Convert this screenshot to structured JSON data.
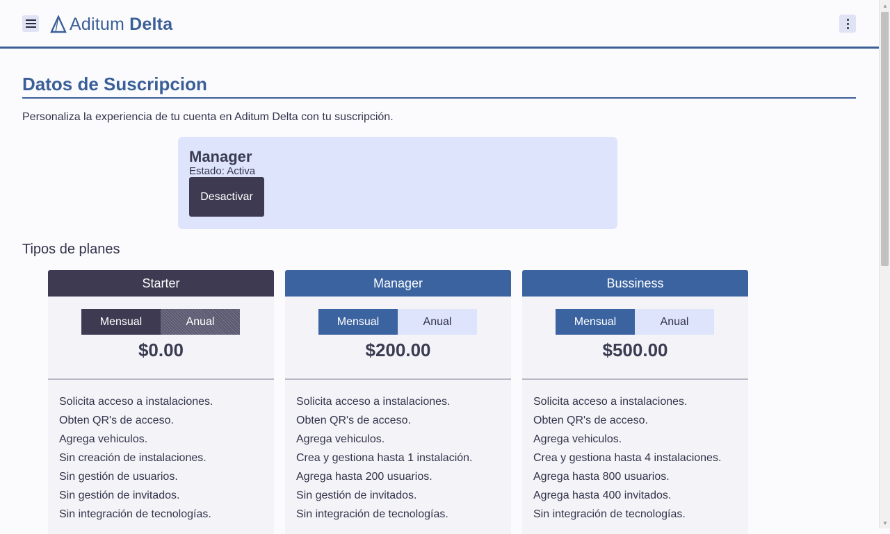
{
  "header": {
    "brand_light": "Aditum",
    "brand_bold": "Delta"
  },
  "page": {
    "title": "Datos de Suscripcion",
    "description": "Personaliza la experiencia de tu cuenta en Aditum Delta con tu suscripción."
  },
  "subscription": {
    "plan": "Manager",
    "status": "Estado: Activa",
    "button": "Desactivar"
  },
  "plans_heading": "Tipos de planes",
  "plans": [
    {
      "name": "Starter",
      "monthly": "Mensual",
      "annual": "Anual",
      "price": "$0.00",
      "features": [
        "Solicita acceso a instalaciones.",
        "Obten QR's de acceso.",
        "Agrega vehiculos.",
        "Sin creación de instalaciones.",
        "Sin gestión de usuarios.",
        "Sin gestión de invitados.",
        "Sin integración de tecnologías."
      ]
    },
    {
      "name": "Manager",
      "monthly": "Mensual",
      "annual": "Anual",
      "price": "$200.00",
      "features": [
        "Solicita acceso a instalaciones.",
        "Obten QR's de acceso.",
        "Agrega vehiculos.",
        "Crea y gestiona hasta 1 instalación.",
        "Agrega hasta 200 usuarios.",
        "Sin gestión de invitados.",
        "Sin integración de tecnologías."
      ]
    },
    {
      "name": "Bussiness",
      "monthly": "Mensual",
      "annual": "Anual",
      "price": "$500.00",
      "features": [
        "Solicita acceso a instalaciones.",
        "Obten QR's de acceso.",
        "Agrega vehiculos.",
        "Crea y gestiona hasta 4 instalaciones.",
        "Agrega hasta 800 usuarios.",
        "Agrega hasta 400 invitados.",
        "Sin integración de tecnologías."
      ]
    }
  ],
  "colors": {
    "primary": "#3a5f97",
    "plan_blue": "#3a63a0",
    "dark": "#3e3a52",
    "card_bg": "#dde4fb"
  },
  "icons": {
    "menu": "hamburger-menu-icon",
    "logo": "triangle-logo-icon",
    "more": "kebab-menu-icon"
  }
}
